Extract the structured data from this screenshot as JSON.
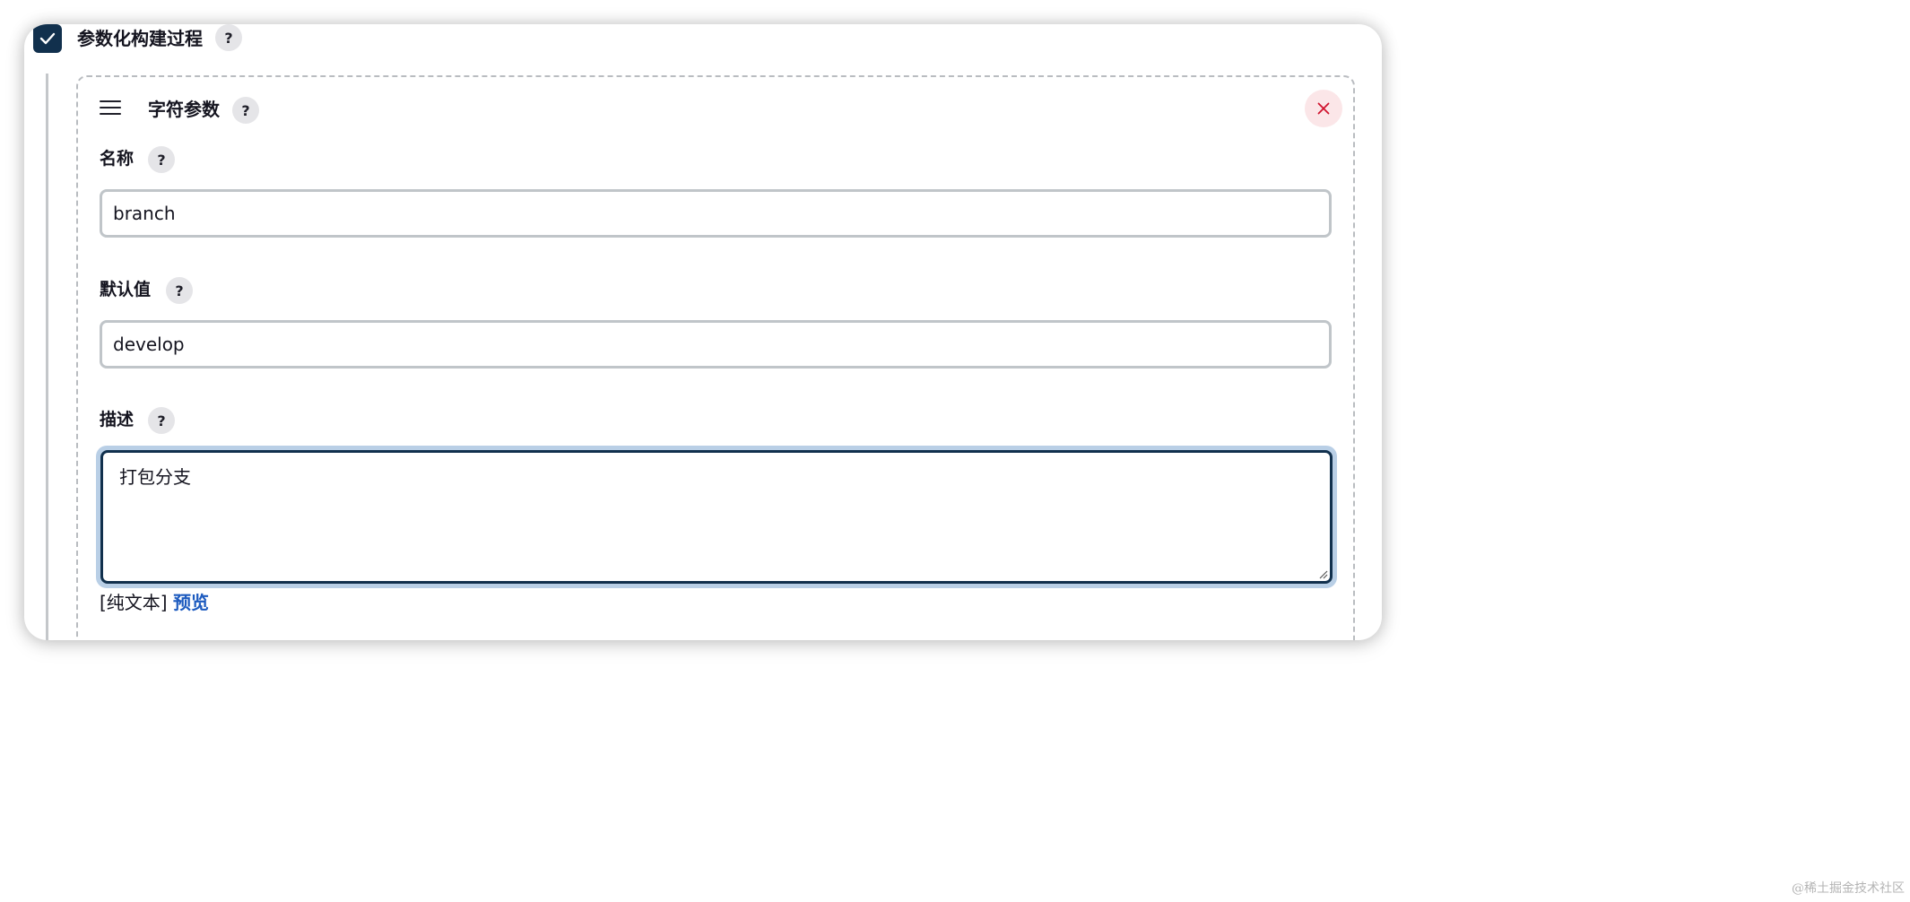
{
  "section": {
    "checkbox_checked": true,
    "title": "参数化构建过程",
    "help": "?"
  },
  "param": {
    "type_title": "字符参数",
    "help": "?",
    "fields": {
      "name": {
        "label": "名称",
        "help": "?",
        "value": "branch"
      },
      "default": {
        "label": "默认值",
        "help": "?",
        "value": "develop"
      },
      "description": {
        "label": "描述",
        "help": "?",
        "value": "打包分支"
      }
    },
    "format": {
      "plain": "[纯文本]",
      "preview": "预览"
    }
  },
  "colors": {
    "checkbox_bg": "#11304d",
    "focus_border": "#11304d",
    "focus_ring": "#b9cfe6",
    "link": "#1d5bbf",
    "remove_icon": "#d0122e",
    "remove_bg": "#fbe6e8"
  },
  "icons": {
    "checkbox": "checkmark-icon",
    "drag": "drag-handle-icon",
    "remove": "close-icon"
  },
  "watermark": "@稀土掘金技术社区"
}
